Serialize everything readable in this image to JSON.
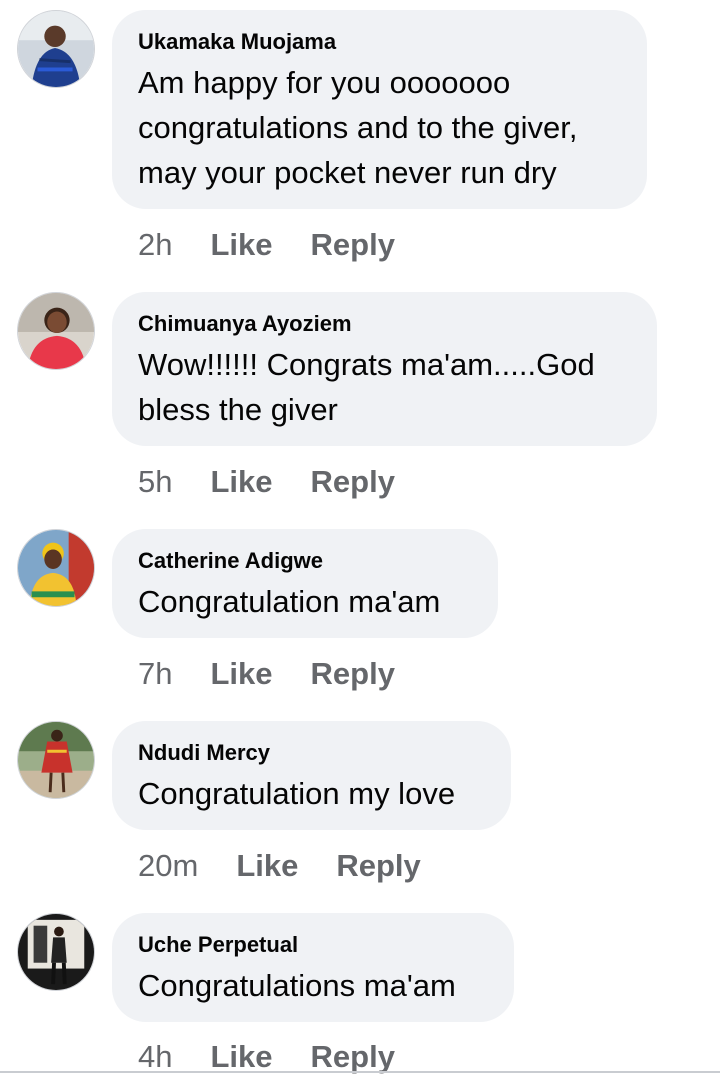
{
  "comments": [
    {
      "author": "Ukamaka Muojama",
      "text_lines": [
        "Am happy for you ooooooo",
        "congratulations and to the giver,",
        "may your pocket never run dry"
      ],
      "time": "2h",
      "like_label": "Like",
      "reply_label": "Reply"
    },
    {
      "author": "Chimuanya Ayoziem",
      "text_lines": [
        "Wow!!!!!! Congrats ma'am.....God",
        "bless the giver"
      ],
      "time": "5h",
      "like_label": "Like",
      "reply_label": "Reply"
    },
    {
      "author": "Catherine Adigwe",
      "text_lines": [
        "Congratulation ma'am"
      ],
      "time": "7h",
      "like_label": "Like",
      "reply_label": "Reply"
    },
    {
      "author": "Ndudi Mercy",
      "text_lines": [
        "Congratulation my love"
      ],
      "time": "20m",
      "like_label": "Like",
      "reply_label": "Reply"
    },
    {
      "author": "Uche Perpetual",
      "text_lines": [
        "Congratulations ma'am"
      ],
      "time": "4h",
      "like_label": "Like",
      "reply_label": "Reply"
    }
  ],
  "colors": {
    "bubble_bg": "#f0f2f5",
    "meta_text": "#65676b",
    "primary_text": "#050505"
  }
}
